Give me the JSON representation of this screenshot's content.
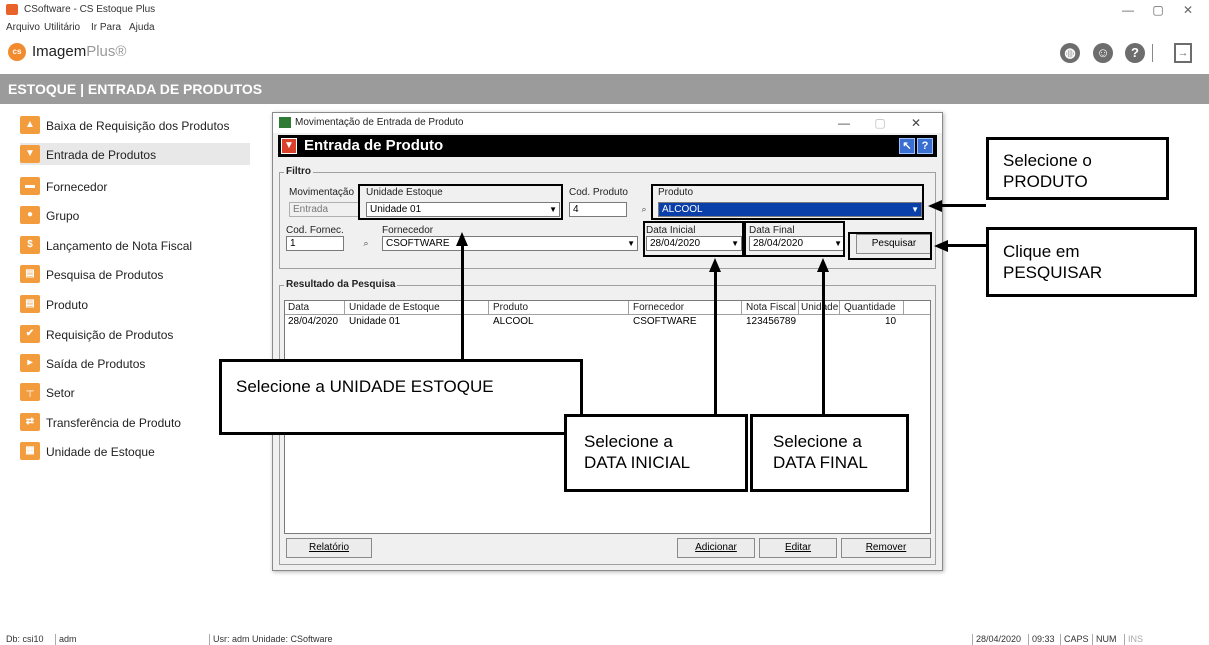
{
  "window": {
    "title": "CSoftware - CS Estoque Plus",
    "controls": {
      "minimize": "—",
      "maximize": "▢",
      "close": "✕"
    }
  },
  "menu": [
    "Arquivo",
    "Utilitário",
    "Ir Para",
    "Ajuda"
  ],
  "brand": {
    "logo_badge": "cs",
    "name": "Imagem",
    "suffix": "Plus®"
  },
  "toolbar_icons": [
    "globe-icon",
    "support-agent-icon",
    "help-icon",
    "exit-icon"
  ],
  "section_title": "ESTOQUE  |  ENTRADA DE PRODUTOS",
  "sidebar": {
    "items": [
      {
        "label": "Baixa de Requisição dos Produtos",
        "icon": "clipboard-icon"
      },
      {
        "label": "Entrada de Produtos",
        "icon": "box-in-icon",
        "active": true
      },
      {
        "label": "Fornecedor",
        "icon": "truck-icon"
      },
      {
        "label": "Grupo",
        "icon": "group-icon"
      },
      {
        "label": "Lançamento de Nota Fiscal",
        "icon": "invoice-icon"
      },
      {
        "label": "Pesquisa de Produtos",
        "icon": "search-box-icon"
      },
      {
        "label": "Produto",
        "icon": "product-icon"
      },
      {
        "label": "Requisição de Produtos",
        "icon": "request-icon"
      },
      {
        "label": "Saída de Produtos",
        "icon": "box-out-icon"
      },
      {
        "label": "Setor",
        "icon": "org-chart-icon"
      },
      {
        "label": "Transferência de Produto",
        "icon": "transfer-icon"
      },
      {
        "label": "Unidade de Estoque",
        "icon": "warehouse-icon"
      }
    ]
  },
  "dialog": {
    "title": "Movimentação de Entrada de Produto",
    "header": "Entrada de Produto",
    "filter": {
      "group_title": "Filtro",
      "movimentacao": {
        "label": "Movimentação",
        "value": "Entrada"
      },
      "unidade_estoque": {
        "label": "Unidade Estoque",
        "value": "Unidade 01"
      },
      "cod_produto": {
        "label": "Cod. Produto",
        "value": "4"
      },
      "produto": {
        "label": "Produto",
        "value": "ALCOOL"
      },
      "cod_fornec": {
        "label": "Cod. Fornec.",
        "value": "1"
      },
      "fornecedor": {
        "label": "Fornecedor",
        "value": "CSOFTWARE"
      },
      "data_inicial": {
        "label": "Data Inicial",
        "value": "28/04/2020"
      },
      "data_final": {
        "label": "Data Final",
        "value": "28/04/2020"
      },
      "search_button": "Pesquisar"
    },
    "results": {
      "group_title": "Resultado da Pesquisa",
      "columns": [
        "Data",
        "Unidade de Estoque",
        "Produto",
        "Fornecedor",
        "Nota Fiscal",
        "Unidade",
        "Quantidade"
      ],
      "rows": [
        [
          "28/04/2020",
          "Unidade 01",
          "ALCOOL",
          "CSOFTWARE",
          "123456789",
          "",
          "10"
        ]
      ]
    },
    "buttons": {
      "report": "Relatório",
      "add": "Adicionar",
      "edit": "Editar",
      "remove": "Remover"
    }
  },
  "callouts": {
    "produto": [
      "Selecione o",
      "PRODUTO"
    ],
    "pesquisar": [
      "Clique em",
      "PESQUISAR"
    ],
    "unidade": [
      "Selecione a UNIDADE ESTOQUE"
    ],
    "data_inicial": [
      "Selecione a",
      "DATA INICIAL"
    ],
    "data_final": [
      "Selecione a",
      "DATA FINAL"
    ]
  },
  "statusbar": {
    "db": "Db: csi10",
    "user_short": "adm",
    "user_unit": "Usr: adm  Unidade: CSoftware",
    "date": "28/04/2020",
    "time": "09:33",
    "caps": "CAPS",
    "num": "NUM",
    "ins": "INS"
  }
}
